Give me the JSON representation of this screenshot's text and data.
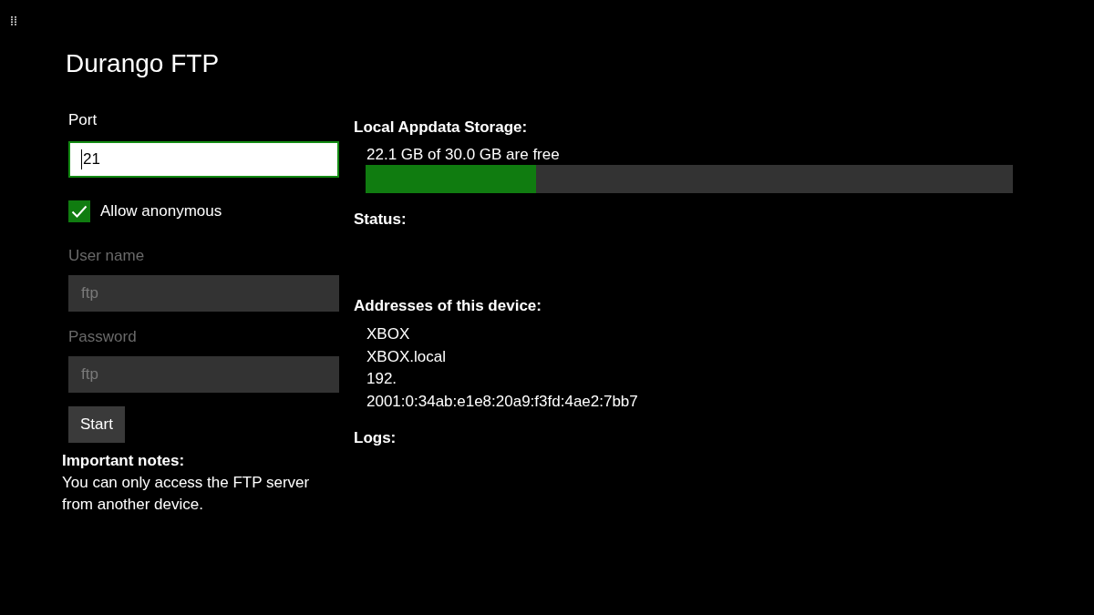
{
  "app": {
    "title": "Durango FTP"
  },
  "settings": {
    "port": {
      "label": "Port",
      "value": "21",
      "focused": true,
      "disabled": false
    },
    "allow_anonymous": {
      "label": "Allow anonymous",
      "checked": true
    },
    "user_name": {
      "label": "User name",
      "value": "ftp",
      "focused": false,
      "disabled": true
    },
    "password": {
      "label": "Password",
      "value": "ftp",
      "focused": false,
      "disabled": true
    },
    "start_button": {
      "label": "Start"
    }
  },
  "notes": {
    "title": "Important notes:",
    "text": "You can only access the FTP server from another device."
  },
  "storage": {
    "heading": "Local Appdata Storage:",
    "summary": "22.1 GB of 30.0 GB are free",
    "level": 0.263
  },
  "status": {
    "heading": "Status:"
  },
  "addresses": {
    "heading": "Addresses of this device:",
    "items": [
      "XBOX",
      "XBOX.local",
      "192.",
      "2001:0:34ab:e1e8:20a9:f3fd:4ae2:7bb7"
    ]
  },
  "logs": {
    "heading": "Logs:"
  }
}
